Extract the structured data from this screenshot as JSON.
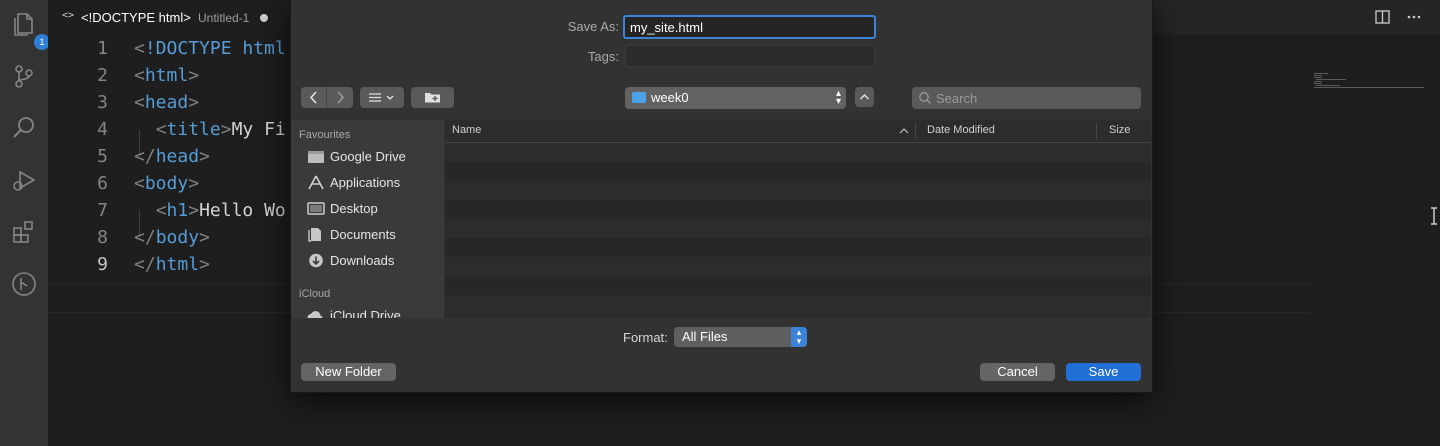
{
  "activity_bar": {
    "explorer_badge": "1",
    "icons": [
      "files-icon",
      "source-control-icon",
      "search-icon",
      "run-debug-icon",
      "extensions-icon",
      "git-graph-icon"
    ]
  },
  "tab": {
    "chevron": "<>",
    "title": "<!DOCTYPE html>",
    "filename": "Untitled-1"
  },
  "editor": {
    "lines": [
      {
        "number": "1",
        "parts": [
          [
            "b",
            "<"
          ],
          [
            "t",
            "!DOCTYPE html"
          ]
        ]
      },
      {
        "number": "2",
        "parts": [
          [
            "b",
            "<"
          ],
          [
            "t",
            "html"
          ],
          [
            "b",
            ">"
          ]
        ]
      },
      {
        "number": "3",
        "parts": [
          [
            "b",
            "<"
          ],
          [
            "t",
            "head"
          ],
          [
            "b",
            ">"
          ]
        ]
      },
      {
        "number": "4",
        "parts": [
          [
            "x",
            "  "
          ],
          [
            "b",
            "<"
          ],
          [
            "t",
            "title"
          ],
          [
            "b",
            ">"
          ],
          [
            "x",
            "My Fi"
          ]
        ]
      },
      {
        "number": "5",
        "parts": [
          [
            "b",
            "</"
          ],
          [
            "t",
            "head"
          ],
          [
            "b",
            ">"
          ]
        ]
      },
      {
        "number": "6",
        "parts": [
          [
            "b",
            "<"
          ],
          [
            "t",
            "body"
          ],
          [
            "b",
            ">"
          ]
        ]
      },
      {
        "number": "7",
        "parts": [
          [
            "x",
            "  "
          ],
          [
            "b",
            "<"
          ],
          [
            "t",
            "h1"
          ],
          [
            "b",
            ">"
          ],
          [
            "x",
            "Hello Wo"
          ]
        ]
      },
      {
        "number": "8",
        "parts": [
          [
            "b",
            "</"
          ],
          [
            "t",
            "body"
          ],
          [
            "b",
            ">"
          ]
        ]
      },
      {
        "number": "9",
        "parts": [
          [
            "b",
            "</"
          ],
          [
            "t",
            "html"
          ],
          [
            "b",
            ">"
          ]
        ]
      }
    ],
    "current_line": "9"
  },
  "dialog": {
    "save_as_label": "Save As:",
    "save_as_value": "my_site.html",
    "tags_label": "Tags:",
    "location": "week0",
    "search_placeholder": "Search",
    "sidebar": {
      "favourites_label": "Favourites",
      "favourites": [
        {
          "label": "Google Drive",
          "icon": "drive-icon"
        },
        {
          "label": "Applications",
          "icon": "applications-icon"
        },
        {
          "label": "Desktop",
          "icon": "desktop-icon"
        },
        {
          "label": "Documents",
          "icon": "documents-icon"
        },
        {
          "label": "Downloads",
          "icon": "downloads-icon"
        }
      ],
      "icloud_label": "iCloud",
      "icloud": [
        {
          "label": "iCloud Drive",
          "icon": "icloud-drive-icon"
        }
      ]
    },
    "columns": {
      "name": "Name",
      "date_modified": "Date Modified",
      "size": "Size"
    },
    "format_label": "Format:",
    "format_value": "All Files",
    "new_folder_label": "New Folder",
    "cancel_label": "Cancel",
    "save_label": "Save"
  },
  "colors": {
    "accent": "#1f6fd4",
    "editor_bg": "#1e1e1e",
    "keyword": "#569cd6"
  }
}
